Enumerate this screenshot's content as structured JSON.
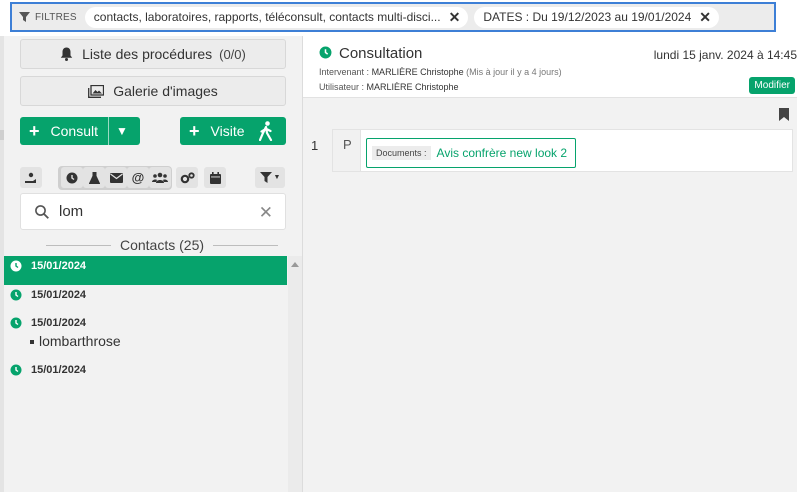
{
  "filterbar": {
    "label": "FILTRES",
    "chips": [
      {
        "text": "contacts, laboratoires, rapports, téléconsult, contacts multi-disci..."
      },
      {
        "text": "DATES : Du 19/12/2023 au 19/01/2024"
      }
    ]
  },
  "left": {
    "procedures_label": "Liste des procédures",
    "procedures_count": "(0/0)",
    "gallery_label": "Galerie d'images",
    "consult_label": "Consult",
    "visite_label": "Visite",
    "search_value": "lom",
    "contacts_header": "Contacts (25)",
    "items": [
      {
        "date": "15/01/2024",
        "sub": "",
        "selected": true
      },
      {
        "date": "15/01/2024",
        "sub": ""
      },
      {
        "date": "15/01/2024",
        "sub": "lombarthrose"
      },
      {
        "date": "15/01/2024",
        "sub": ""
      }
    ]
  },
  "right": {
    "title": "Consultation",
    "datetime": "lundi 15 janv. 2024 à 14:45",
    "intervenant_label": "Intervenant :",
    "intervenant": "MARLIÈRE Christophe",
    "updated": "(Mis à jour il y a 4 jours)",
    "utilisateur_label": "Utilisateur :",
    "utilisateur": "MARLIÈRE Christophe",
    "modifier_label": "Modifier",
    "row_number": "1",
    "row_type": "P",
    "doc_tag": "Documents :",
    "doc_label": "Avis confrère new look 2"
  },
  "colors": {
    "accent": "#06a36c",
    "focus": "#3d7fd6"
  }
}
